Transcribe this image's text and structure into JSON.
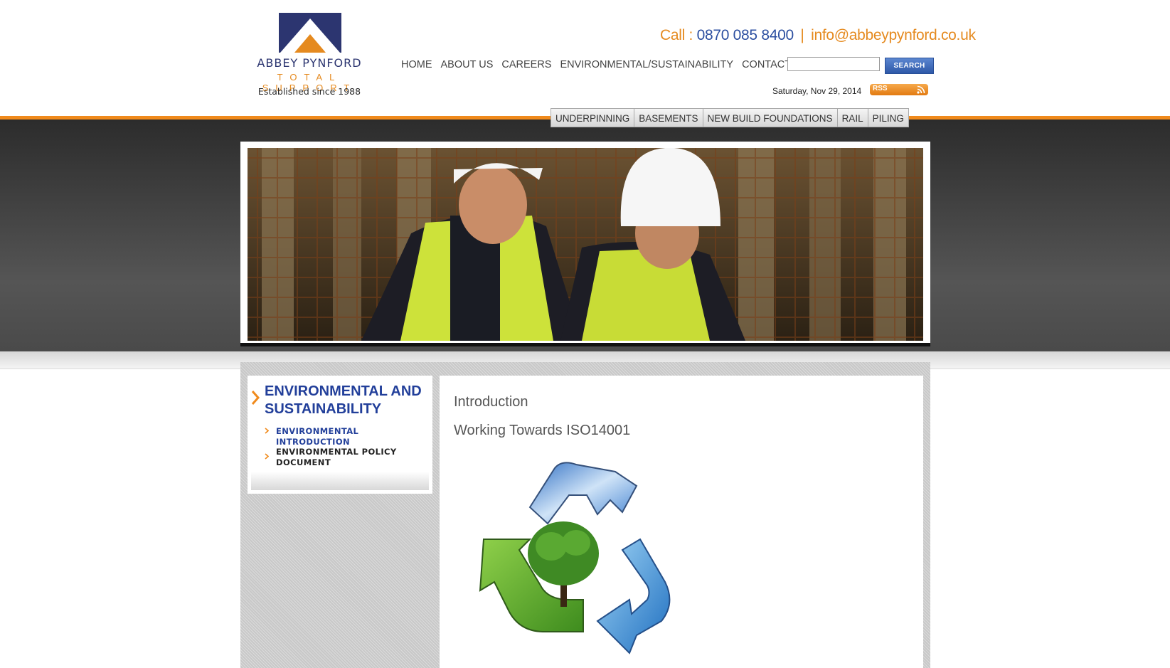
{
  "header": {
    "logo": {
      "brand": "ABBEY PYNFORD",
      "tagline": "TOTAL SUPPORT",
      "established": "Established since 1988"
    },
    "contact": {
      "call_label": "Call :",
      "phone": "0870 085 8400",
      "separator": "|",
      "email": "info@abbeypynford.co.uk"
    },
    "nav": [
      "HOME",
      "ABOUT US",
      "CAREERS",
      "ENVIRONMENTAL/SUSTAINABILITY",
      "CONTACT"
    ],
    "search": {
      "placeholder": "",
      "button_label": "SEARCH"
    },
    "date": "Saturday, Nov 29, 2014",
    "rss_label": "RSS",
    "subnav": [
      "UNDERPINNING",
      "BASEMENTS",
      "NEW BUILD FOUNDATIONS",
      "RAIL",
      "PILING"
    ]
  },
  "sidebar": {
    "title": "ENVIRONMENTAL AND SUSTAINABILITY",
    "items": [
      {
        "label": "ENVIRONMENTAL INTRODUCTION"
      },
      {
        "label": "ENVIRONMENTAL POLICY DOCUMENT"
      }
    ]
  },
  "main": {
    "intro_heading": "Introduction",
    "iso_heading": "Working Towards ISO14001"
  },
  "colors": {
    "brand_navy": "#2c3570",
    "accent_orange": "#f08a1c",
    "link_blue": "#223f9a",
    "search_blue": "#2e58a8"
  },
  "icons": [
    "logo-mark-icon",
    "rss-feed-icon",
    "chevron-right-icon",
    "recycle-icon"
  ]
}
